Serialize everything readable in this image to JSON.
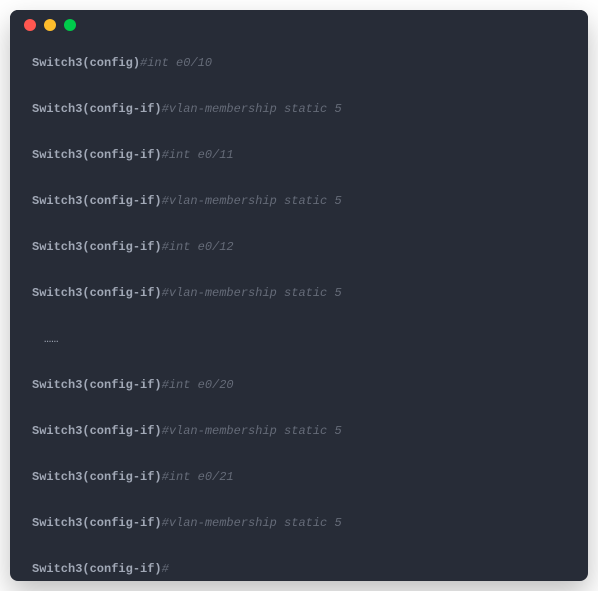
{
  "titlebar": {
    "buttons": [
      "close",
      "minimize",
      "zoom"
    ]
  },
  "terminal": {
    "lines": [
      {
        "prompt": "Switch3(config)",
        "comment": "#int e0/10"
      },
      {
        "prompt": "Switch3(config-if)",
        "comment": "#vlan-membership static 5"
      },
      {
        "prompt": "Switch3(config-if)",
        "comment": "#int e0/11"
      },
      {
        "prompt": "Switch3(config-if)",
        "comment": "#vlan-membership static 5"
      },
      {
        "prompt": "Switch3(config-if)",
        "comment": "#int e0/12"
      },
      {
        "prompt": "Switch3(config-if)",
        "comment": "#vlan-membership static 5"
      },
      {
        "ellipsis": "……"
      },
      {
        "prompt": "Switch3(config-if)",
        "comment": "#int e0/20"
      },
      {
        "prompt": "Switch3(config-if)",
        "comment": "#vlan-membership static 5"
      },
      {
        "prompt": "Switch3(config-if)",
        "comment": "#int e0/21"
      },
      {
        "prompt": "Switch3(config-if)",
        "comment": "#vlan-membership static 5"
      },
      {
        "prompt": "Switch3(config-if)",
        "comment": "#"
      }
    ]
  }
}
